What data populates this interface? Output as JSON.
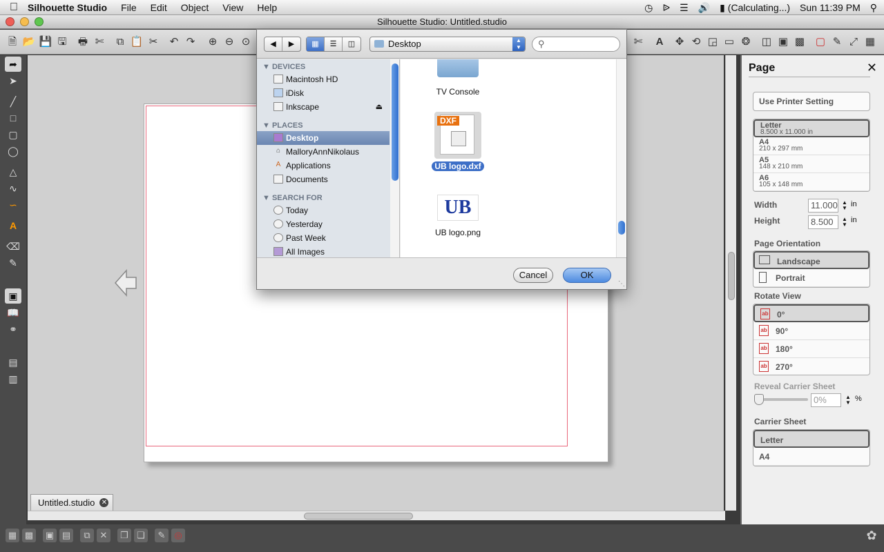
{
  "menubar": {
    "app": "Silhouette Studio",
    "items": [
      "File",
      "Edit",
      "Object",
      "View",
      "Help"
    ],
    "battery": "(Calculating...)",
    "clock": "Sun 11:39 PM"
  },
  "window": {
    "title": "Silhouette Studio: Untitled.studio"
  },
  "document_tab": {
    "label": "Untitled.studio"
  },
  "dialog": {
    "location": "Desktop",
    "sidebar": {
      "devices_header": "DEVICES",
      "devices": [
        "Macintosh HD",
        "iDisk",
        "Inkscape"
      ],
      "places_header": "PLACES",
      "places": [
        "Desktop",
        "MalloryAnnNikolaus",
        "Applications",
        "Documents"
      ],
      "search_header": "SEARCH FOR",
      "searches": [
        "Today",
        "Yesterday",
        "Past Week",
        "All Images"
      ]
    },
    "files": [
      {
        "name": "TV Console",
        "kind": "folder"
      },
      {
        "name": "UB logo.dxf",
        "kind": "dxf",
        "badge": "DXF",
        "selected": true
      },
      {
        "name": "UB logo.png",
        "kind": "png",
        "logo_text": "UB"
      }
    ],
    "cancel_label": "Cancel",
    "ok_label": "OK"
  },
  "page_panel": {
    "title": "Page",
    "use_printer": "Use Printer Setting",
    "sizes": [
      {
        "name": "Letter",
        "dims": "8.500 x 11.000 in",
        "selected": true
      },
      {
        "name": "A4",
        "dims": "210 x 297 mm"
      },
      {
        "name": "A5",
        "dims": "148 x 210 mm"
      },
      {
        "name": "A6",
        "dims": "105 x 148 mm"
      }
    ],
    "width_label": "Width",
    "width_value": "11.000",
    "height_label": "Height",
    "height_value": "8.500",
    "unit": "in",
    "orientation_label": "Page Orientation",
    "orientations": [
      "Landscape",
      "Portrait"
    ],
    "rotate_label": "Rotate View",
    "rotations": [
      "0°",
      "90°",
      "180°",
      "270°"
    ],
    "reveal_label": "Reveal Carrier Sheet",
    "reveal_value": "0%",
    "reveal_unit": "%",
    "carrier_label": "Carrier Sheet",
    "carriers": [
      "Letter",
      "A4"
    ]
  },
  "colors": {
    "accent": "#3d6fc7",
    "cut_line": "#e8667a"
  }
}
